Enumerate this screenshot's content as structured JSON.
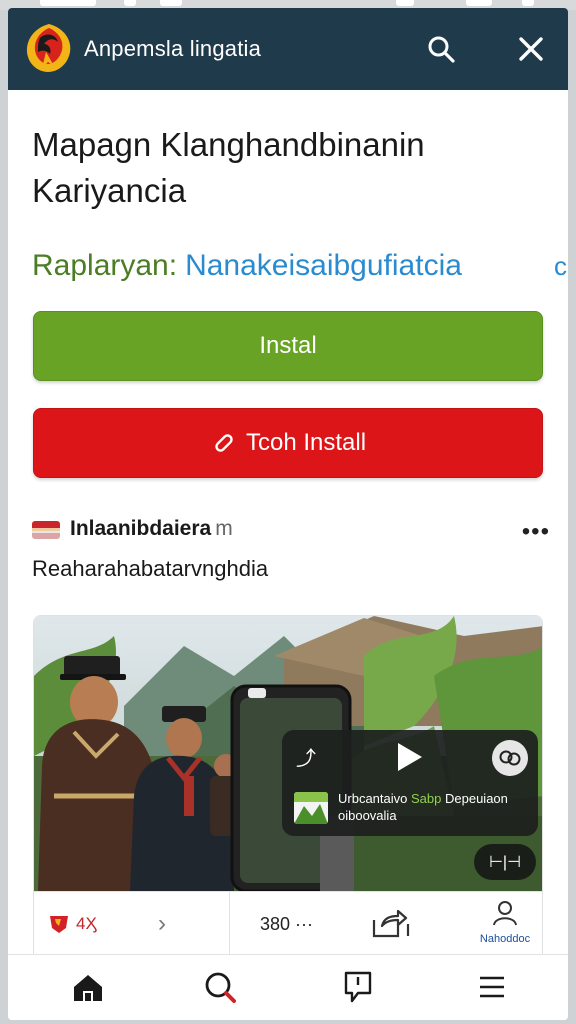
{
  "app_bar": {
    "title": "Anpemsla lingatia",
    "search_icon": "search-icon",
    "close_icon": "close-icon",
    "colors": {
      "background": "#1f3a4a",
      "text": "#ffffff"
    }
  },
  "page": {
    "title": "Mapagn Klanghandbinanin Kariyancia",
    "author_label": "Raplaryan:",
    "author_name": "Nanakeisaibgufiatcia",
    "author_overflow": "c"
  },
  "buttons": {
    "install_label": "Instal",
    "trial_label": "Tcoh Install",
    "colors": {
      "install": "#68a326",
      "trial": "#dc1618"
    }
  },
  "post": {
    "name": "Inlaanibdaiera",
    "name_tail": "m",
    "text": "Reaharahabatarvnghdia",
    "more_icon": "more-dots-icon"
  },
  "media": {
    "player": {
      "caption_pre": "Urbcantaivo",
      "caption_highlight": "Sabp",
      "caption_post": "Depeuiaon oiboovalia",
      "share_icon": "share-icon",
      "play_icon": "play-icon",
      "cc_icon": "captions-icon",
      "fullscreen_label": "⊢|⊣"
    },
    "footer": {
      "count": "4Ӽ",
      "arrow": "›",
      "views": "380 ···",
      "user_label": "Nahoddoc"
    }
  },
  "bottom_nav": {
    "items": [
      "home-icon",
      "search-icon",
      "chat-icon",
      "menu-icon"
    ]
  }
}
